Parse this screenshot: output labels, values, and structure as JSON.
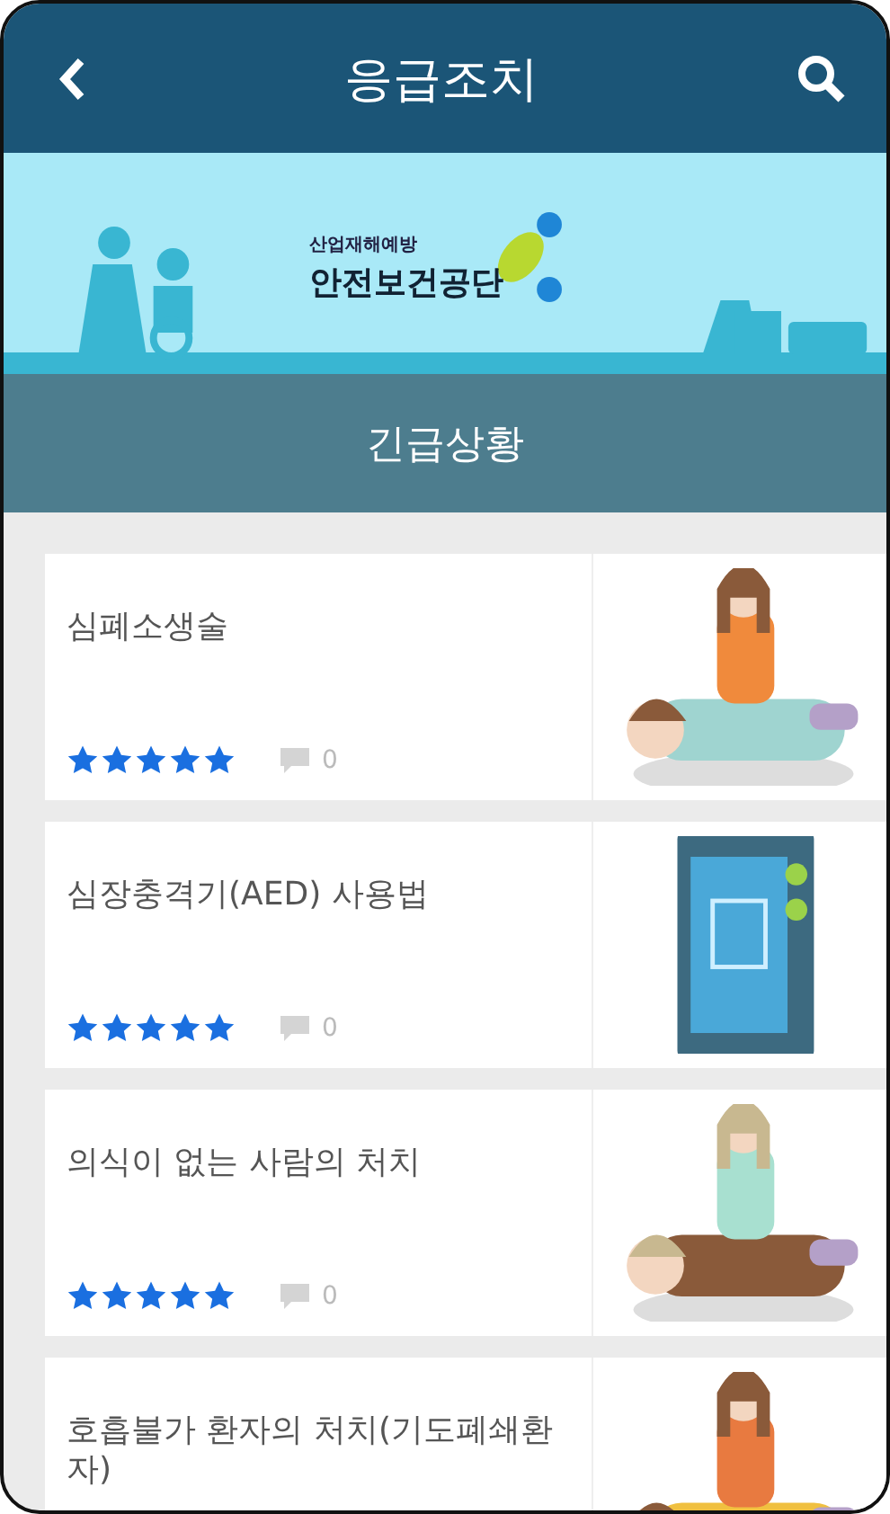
{
  "header": {
    "title": "응급조치"
  },
  "banner": {
    "kind": "picture",
    "logo_subtitle": "산업재해예방",
    "logo_name": "안전보건공단"
  },
  "section": {
    "title": "긴급상황"
  },
  "items": [
    {
      "title": "심폐소생술",
      "stars": 5,
      "comments": "0"
    },
    {
      "title": "심장충격기(AED) 사용법",
      "stars": 5,
      "comments": "0"
    },
    {
      "title": "의식이 없는 사람의 처치",
      "stars": 5,
      "comments": "0"
    },
    {
      "title": "호흡불가 환자의 처치(기도폐쇄환자)"
    }
  ]
}
